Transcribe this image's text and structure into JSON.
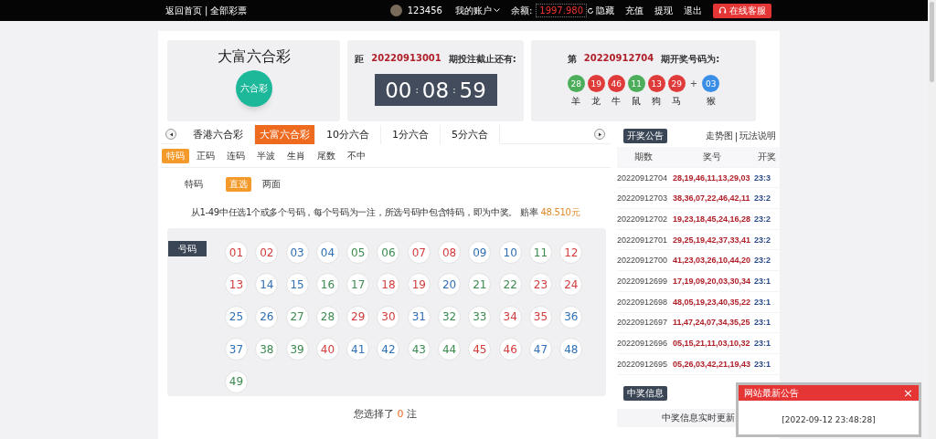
{
  "top_bar": {
    "links_left": [
      "返回首页",
      "全部彩票"
    ],
    "links_separator": "|",
    "username": "123456",
    "account_menu": "我的账户",
    "balance_label": "余额:",
    "balance": "1997.980",
    "hide_toggle": "隐藏",
    "actions": [
      "充值",
      "提现",
      "退出"
    ],
    "support_button": "在线客服"
  },
  "lottery": {
    "name": "大富六合彩",
    "logo_text": "六合彩"
  },
  "countdown": {
    "prefix": "距",
    "issue": "20220913001",
    "suffix": "期投注截止还有:",
    "hours": "00",
    "minutes": "08",
    "seconds": "59",
    "colon": ":"
  },
  "last_draw": {
    "prefix": "第",
    "issue": "20220912704",
    "suffix": "期开奖号码为:",
    "plus": "+",
    "balls": [
      {
        "number": "28",
        "zodiac": "羊",
        "color": "#4cae5a"
      },
      {
        "number": "19",
        "zodiac": "龙",
        "color": "#e03b3b"
      },
      {
        "number": "46",
        "zodiac": "牛",
        "color": "#e03b3b"
      },
      {
        "number": "11",
        "zodiac": "鼠",
        "color": "#4cae5a"
      },
      {
        "number": "13",
        "zodiac": "狗",
        "color": "#e03b3b"
      },
      {
        "number": "29",
        "zodiac": "马",
        "color": "#e03b3b"
      }
    ],
    "special": {
      "number": "03",
      "zodiac": "猴",
      "color": "#3a8ee6"
    }
  },
  "game_tabs": [
    {
      "label": "香港六合彩",
      "selected": false
    },
    {
      "label": "大富六合彩",
      "selected": true
    },
    {
      "label": "10分六合",
      "selected": false
    },
    {
      "label": "1分六合",
      "selected": false
    },
    {
      "label": "5分六合",
      "selected": false
    }
  ],
  "play_tabs": [
    {
      "label": "特码",
      "selected": true
    },
    {
      "label": "正码",
      "selected": false
    },
    {
      "label": "连码",
      "selected": false
    },
    {
      "label": "半波",
      "selected": false
    },
    {
      "label": "生肖",
      "selected": false
    },
    {
      "label": "尾数",
      "selected": false
    },
    {
      "label": "不中",
      "selected": false
    }
  ],
  "mode": {
    "label": "特码",
    "options": [
      {
        "label": "直选",
        "selected": true
      },
      {
        "label": "两面",
        "selected": false
      }
    ]
  },
  "description": "从1-49中任选1个或多个号码，每个号码为一注，所选号码中包含特码，即为中奖。 赔率",
  "odds": "48.510元",
  "number_panel": {
    "label": "号码",
    "balls": [
      {
        "number": "01",
        "color": "#d23b3b"
      },
      {
        "number": "02",
        "color": "#d23b3b"
      },
      {
        "number": "03",
        "color": "#2f6fb5"
      },
      {
        "number": "04",
        "color": "#2f6fb5"
      },
      {
        "number": "05",
        "color": "#3b8a4e"
      },
      {
        "number": "06",
        "color": "#3b8a4e"
      },
      {
        "number": "07",
        "color": "#d23b3b"
      },
      {
        "number": "08",
        "color": "#d23b3b"
      },
      {
        "number": "09",
        "color": "#2f6fb5"
      },
      {
        "number": "10",
        "color": "#2f6fb5"
      },
      {
        "number": "11",
        "color": "#3b8a4e"
      },
      {
        "number": "12",
        "color": "#d23b3b"
      },
      {
        "number": "13",
        "color": "#d23b3b"
      },
      {
        "number": "14",
        "color": "#2f6fb5"
      },
      {
        "number": "15",
        "color": "#2f6fb5"
      },
      {
        "number": "16",
        "color": "#3b8a4e"
      },
      {
        "number": "17",
        "color": "#3b8a4e"
      },
      {
        "number": "18",
        "color": "#d23b3b"
      },
      {
        "number": "19",
        "color": "#d23b3b"
      },
      {
        "number": "20",
        "color": "#2f6fb5"
      },
      {
        "number": "21",
        "color": "#3b8a4e"
      },
      {
        "number": "22",
        "color": "#3b8a4e"
      },
      {
        "number": "23",
        "color": "#d23b3b"
      },
      {
        "number": "24",
        "color": "#d23b3b"
      },
      {
        "number": "25",
        "color": "#2f6fb5"
      },
      {
        "number": "26",
        "color": "#2f6fb5"
      },
      {
        "number": "27",
        "color": "#3b8a4e"
      },
      {
        "number": "28",
        "color": "#3b8a4e"
      },
      {
        "number": "29",
        "color": "#d23b3b"
      },
      {
        "number": "30",
        "color": "#d23b3b"
      },
      {
        "number": "31",
        "color": "#2f6fb5"
      },
      {
        "number": "32",
        "color": "#3b8a4e"
      },
      {
        "number": "33",
        "color": "#3b8a4e"
      },
      {
        "number": "34",
        "color": "#d23b3b"
      },
      {
        "number": "35",
        "color": "#d23b3b"
      },
      {
        "number": "36",
        "color": "#2f6fb5"
      },
      {
        "number": "37",
        "color": "#2f6fb5"
      },
      {
        "number": "38",
        "color": "#3b8a4e"
      },
      {
        "number": "39",
        "color": "#3b8a4e"
      },
      {
        "number": "40",
        "color": "#d23b3b"
      },
      {
        "number": "41",
        "color": "#2f6fb5"
      },
      {
        "number": "42",
        "color": "#2f6fb5"
      },
      {
        "number": "43",
        "color": "#3b8a4e"
      },
      {
        "number": "44",
        "color": "#3b8a4e"
      },
      {
        "number": "45",
        "color": "#d23b3b"
      },
      {
        "number": "46",
        "color": "#d23b3b"
      },
      {
        "number": "47",
        "color": "#2f6fb5"
      },
      {
        "number": "48",
        "color": "#2f6fb5"
      },
      {
        "number": "49",
        "color": "#3b8a4e"
      }
    ]
  },
  "selection_summary": {
    "prefix": "您选择了",
    "count": "0",
    "suffix": "注"
  },
  "results": {
    "title": "开奖公告",
    "links": [
      "走势图",
      "玩法说明"
    ],
    "links_separator": "|",
    "columns": [
      "期数",
      "奖号",
      "开奖"
    ],
    "rows": [
      {
        "issue": "20220912704",
        "numbers": "28,19,46,11,13,29,03",
        "time": "23:3"
      },
      {
        "issue": "20220912703",
        "numbers": "38,36,07,22,46,42,11",
        "time": "23:2"
      },
      {
        "issue": "20220912702",
        "numbers": "19,23,18,45,24,16,28",
        "time": "23:2"
      },
      {
        "issue": "20220912701",
        "numbers": "29,25,19,42,37,33,41",
        "time": "23:2"
      },
      {
        "issue": "20220912700",
        "numbers": "41,23,03,26,10,44,20",
        "time": "23:2"
      },
      {
        "issue": "20220912699",
        "numbers": "17,19,09,20,03,30,34",
        "time": "23:1"
      },
      {
        "issue": "20220912698",
        "numbers": "48,05,19,23,40,35,22",
        "time": "23:1"
      },
      {
        "issue": "20220912697",
        "numbers": "11,47,24,07,34,35,25",
        "time": "23:1"
      },
      {
        "issue": "20220912696",
        "numbers": "05,15,21,11,03,10,32",
        "time": "23:1"
      },
      {
        "issue": "20220912695",
        "numbers": "05,26,03,42,21,19,43",
        "time": "23:1"
      }
    ]
  },
  "winners": {
    "title": "中奖信息",
    "note": "中奖信息实时更新"
  },
  "notice_popup": {
    "title": "网站最新公告",
    "close": "×",
    "timestamp": "[2022-09-12 23:48:28]"
  }
}
